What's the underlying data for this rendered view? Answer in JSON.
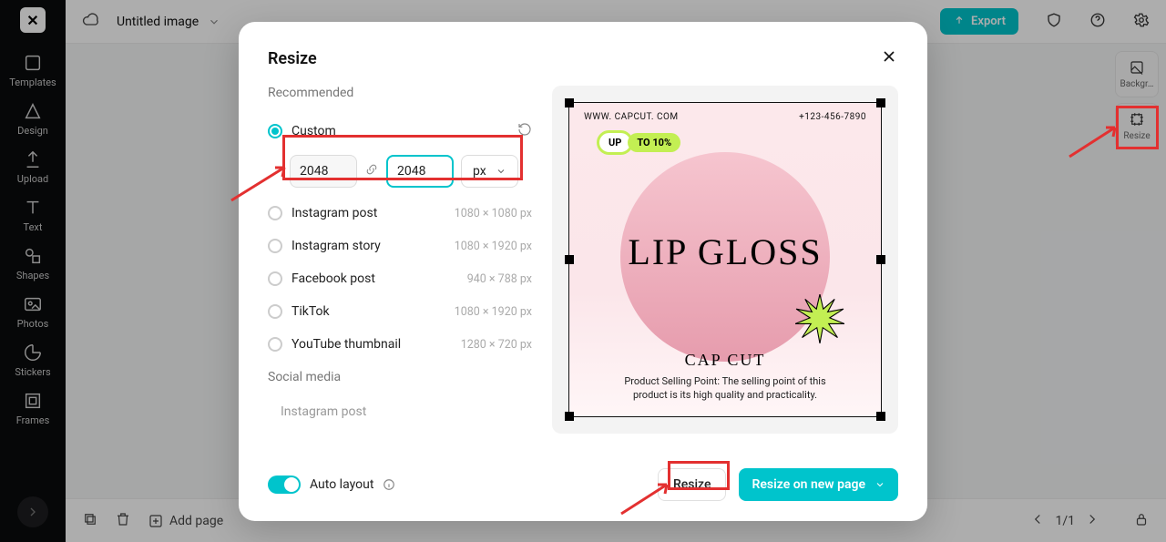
{
  "accent": "#00c4cc",
  "topbar": {
    "title": "Untitled image",
    "export_label": "Export"
  },
  "sidebar": {
    "items": [
      {
        "label": "Templates"
      },
      {
        "label": "Design"
      },
      {
        "label": "Upload"
      },
      {
        "label": "Text"
      },
      {
        "label": "Shapes"
      },
      {
        "label": "Photos"
      },
      {
        "label": "Stickers"
      },
      {
        "label": "Frames"
      }
    ]
  },
  "right_panel": {
    "items": [
      {
        "label": "Backgr…"
      },
      {
        "label": "Resize"
      }
    ]
  },
  "bottombar": {
    "add_page": "Add page",
    "page_indicator": "1/1"
  },
  "modal": {
    "title": "Resize",
    "recommended_label": "Recommended",
    "custom_label": "Custom",
    "width_value": "2048",
    "height_value": "2048",
    "unit": "px",
    "options": [
      {
        "label": "Instagram post",
        "dims": "1080 × 1080 px"
      },
      {
        "label": "Instagram story",
        "dims": "1080 × 1920 px"
      },
      {
        "label": "Facebook post",
        "dims": "940 × 788 px"
      },
      {
        "label": "TikTok",
        "dims": "1080 × 1920 px"
      },
      {
        "label": "YouTube thumbnail",
        "dims": "1280 × 720 px"
      }
    ],
    "social_header": "Social media",
    "social_sub": "Instagram post",
    "auto_layout_label": "Auto layout",
    "resize_btn": "Resize",
    "new_page_btn": "Resize on new page"
  },
  "preview": {
    "url": "WWW. CAPCUT. COM",
    "phone": "+123-456-7890",
    "badge_up": "UP",
    "badge_to": "TO 10%",
    "headline": "LIP GLOSS",
    "brand": "CAP CUT",
    "desc": "Product Selling Point: The selling point of this product is its high quality and practicality."
  }
}
